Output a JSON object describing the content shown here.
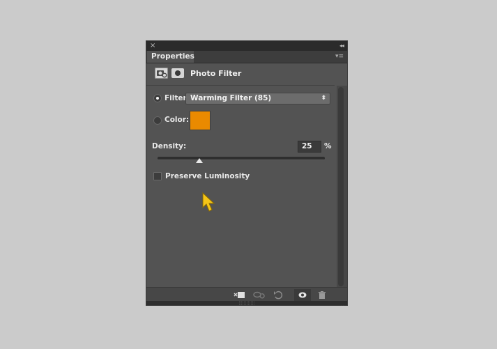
{
  "panel": {
    "close_symbol": "×",
    "collapse_symbol": "◂◂",
    "tab_label": "Properties",
    "menu_symbol": "▾≡",
    "adjustment_icon": "adjustment-layer-icon",
    "mask_icon": "layer-mask-icon",
    "header_title": "Photo Filter"
  },
  "filter": {
    "label": "Filter:",
    "selected": true,
    "value": "Warming Filter (85)",
    "arrow": "⬍"
  },
  "color": {
    "label": "Color:",
    "selected": false,
    "swatch_color": "#ea8a00"
  },
  "density": {
    "label": "Density:",
    "value": "25",
    "unit": "%",
    "fraction": 0.25
  },
  "preserve_luminosity": {
    "label": "Preserve Luminosity",
    "checked": false
  },
  "cursor": {
    "icon": "arrow-cursor-icon",
    "color": "#f5c518"
  },
  "footer": {
    "buttons": [
      {
        "name": "clip-to-layer",
        "icon": "clip-to-layer-icon"
      },
      {
        "name": "view-previous-state",
        "icon": "view-previous-state-icon"
      },
      {
        "name": "reset-adjustment",
        "icon": "reset-icon"
      },
      {
        "name": "toggle-visibility",
        "icon": "eye-icon"
      },
      {
        "name": "delete-layer",
        "icon": "trash-icon"
      }
    ]
  }
}
